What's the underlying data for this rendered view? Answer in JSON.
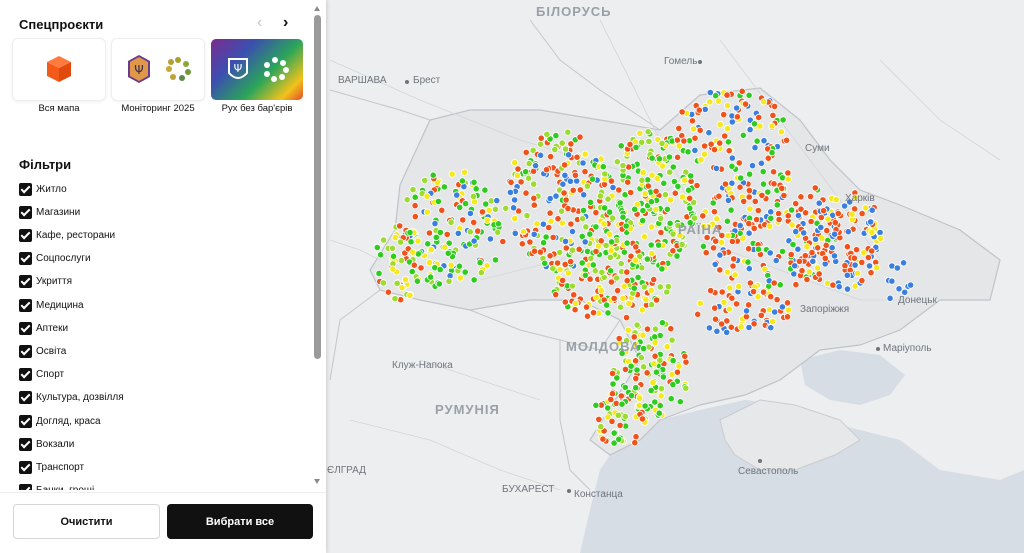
{
  "map": {
    "country_labels": [
      {
        "id": "belarus",
        "text": "БІЛОРУСЬ"
      },
      {
        "id": "moldova",
        "text": "МОЛДОВА"
      },
      {
        "id": "romania",
        "text": "РУМУНІЯ"
      },
      {
        "id": "ukraine",
        "text": "РАЇНА"
      }
    ],
    "city_labels": [
      {
        "id": "warsaw",
        "text": "ВАРШАВА"
      },
      {
        "id": "brest",
        "text": "Брест"
      },
      {
        "id": "gomel",
        "text": "Гомель"
      },
      {
        "id": "sumy",
        "text": "Суми"
      },
      {
        "id": "kharkiv",
        "text": "Харків"
      },
      {
        "id": "donetsk",
        "text": "Донецьк"
      },
      {
        "id": "zaporizhzhia",
        "text": "Запоріжжя"
      },
      {
        "id": "mariupol",
        "text": "Маріуполь"
      },
      {
        "id": "kluzh",
        "text": "Клуж-Напока"
      },
      {
        "id": "bucharest",
        "text": "БУХАРЕСТ"
      },
      {
        "id": "constanta",
        "text": "Констанца"
      },
      {
        "id": "sevastopol",
        "text": "Севастополь"
      },
      {
        "id": "belgrade",
        "text": "ЄЛГРАД"
      }
    ],
    "colors": {
      "red": "#f1521b",
      "green": "#2ecc1e",
      "lightgreen": "#9bdc2e",
      "yellow": "#f5e81d",
      "blue": "#3a7fe0",
      "water": "#d7dde5",
      "land": "#eceef0"
    }
  },
  "panel": {
    "special_projects_title": "Спецпроєкти",
    "prev_icon": "chevron-left-icon",
    "next_icon": "chevron-right-icon",
    "cards": [
      {
        "label": "Вся мапа",
        "icon": "orange-cube-icon"
      },
      {
        "label": "Моніторинг 2025",
        "icon": "trident-monitoring-icon"
      },
      {
        "label": "Рух без бар'єрів",
        "icon": "trident-barrier-free-icon"
      }
    ],
    "filters_title": "Фільтри",
    "filters": [
      {
        "label": "Житло",
        "checked": true
      },
      {
        "label": "Магазини",
        "checked": true
      },
      {
        "label": "Кафе, ресторани",
        "checked": true
      },
      {
        "label": "Соцпослуги",
        "checked": true
      },
      {
        "label": "Укриття",
        "checked": true
      },
      {
        "label": "Медицина",
        "checked": true
      },
      {
        "label": "Аптеки",
        "checked": true
      },
      {
        "label": "Освіта",
        "checked": true
      },
      {
        "label": "Спорт",
        "checked": true
      },
      {
        "label": "Культура, дозвілля",
        "checked": true
      },
      {
        "label": "Догляд, краса",
        "checked": true
      },
      {
        "label": "Вокзали",
        "checked": true
      },
      {
        "label": "Транспорт",
        "checked": true
      },
      {
        "label": "Банки, гроші",
        "checked": true
      }
    ],
    "clear_button": "Очистити",
    "select_all_button": "Вибрати все"
  }
}
